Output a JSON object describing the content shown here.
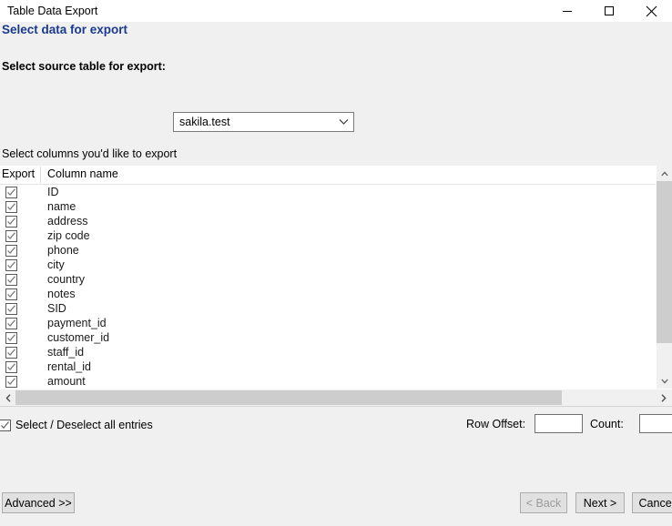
{
  "window": {
    "title": "Table Data Export",
    "controls": {
      "minimize": "minimize-icon",
      "maximize": "maximize-icon",
      "close": "close-icon"
    }
  },
  "page": {
    "title": "Select data for export"
  },
  "source": {
    "label": "Select source table for export:",
    "selected": "sakila.test",
    "arrow_icon": "chevron-down-icon"
  },
  "columns_section": {
    "hint": "Select columns you'd like to export",
    "headers": {
      "export": "Export",
      "column_name": "Column name"
    },
    "rows": [
      {
        "name": "ID",
        "checked": true
      },
      {
        "name": "name",
        "checked": true
      },
      {
        "name": "address",
        "checked": true
      },
      {
        "name": "zip code",
        "checked": true
      },
      {
        "name": "phone",
        "checked": true
      },
      {
        "name": "city",
        "checked": true
      },
      {
        "name": "country",
        "checked": true
      },
      {
        "name": "notes",
        "checked": true
      },
      {
        "name": "SID",
        "checked": true
      },
      {
        "name": "payment_id",
        "checked": true
      },
      {
        "name": "customer_id",
        "checked": true
      },
      {
        "name": "staff_id",
        "checked": true
      },
      {
        "name": "rental_id",
        "checked": true
      },
      {
        "name": "amount",
        "checked": true
      },
      {
        "name": "",
        "checked": true
      }
    ]
  },
  "scrollbars": {
    "vertical": {
      "up_icon": "scroll-up-arrow-icon",
      "down_icon": "scroll-down-arrow-icon"
    },
    "horizontal": {
      "left_icon": "scroll-left-arrow-icon",
      "right_icon": "scroll-right-arrow-icon"
    }
  },
  "footer": {
    "select_all_label": "Select / Deselect all entries",
    "select_all_checked": true,
    "row_offset_label": "Row Offset:",
    "row_offset_value": "",
    "count_label": "Count:",
    "count_value": ""
  },
  "buttons": {
    "advanced": "Advanced >>",
    "back": "< Back",
    "next": "Next >",
    "cancel": "Cancel"
  },
  "colors": {
    "title_blue": "#1a3a8f",
    "dialog_bg": "#f0f0f0",
    "list_bg": "#ffffff",
    "scroll_thumb": "#cdcdcd",
    "button_face": "#e1e1e1"
  }
}
